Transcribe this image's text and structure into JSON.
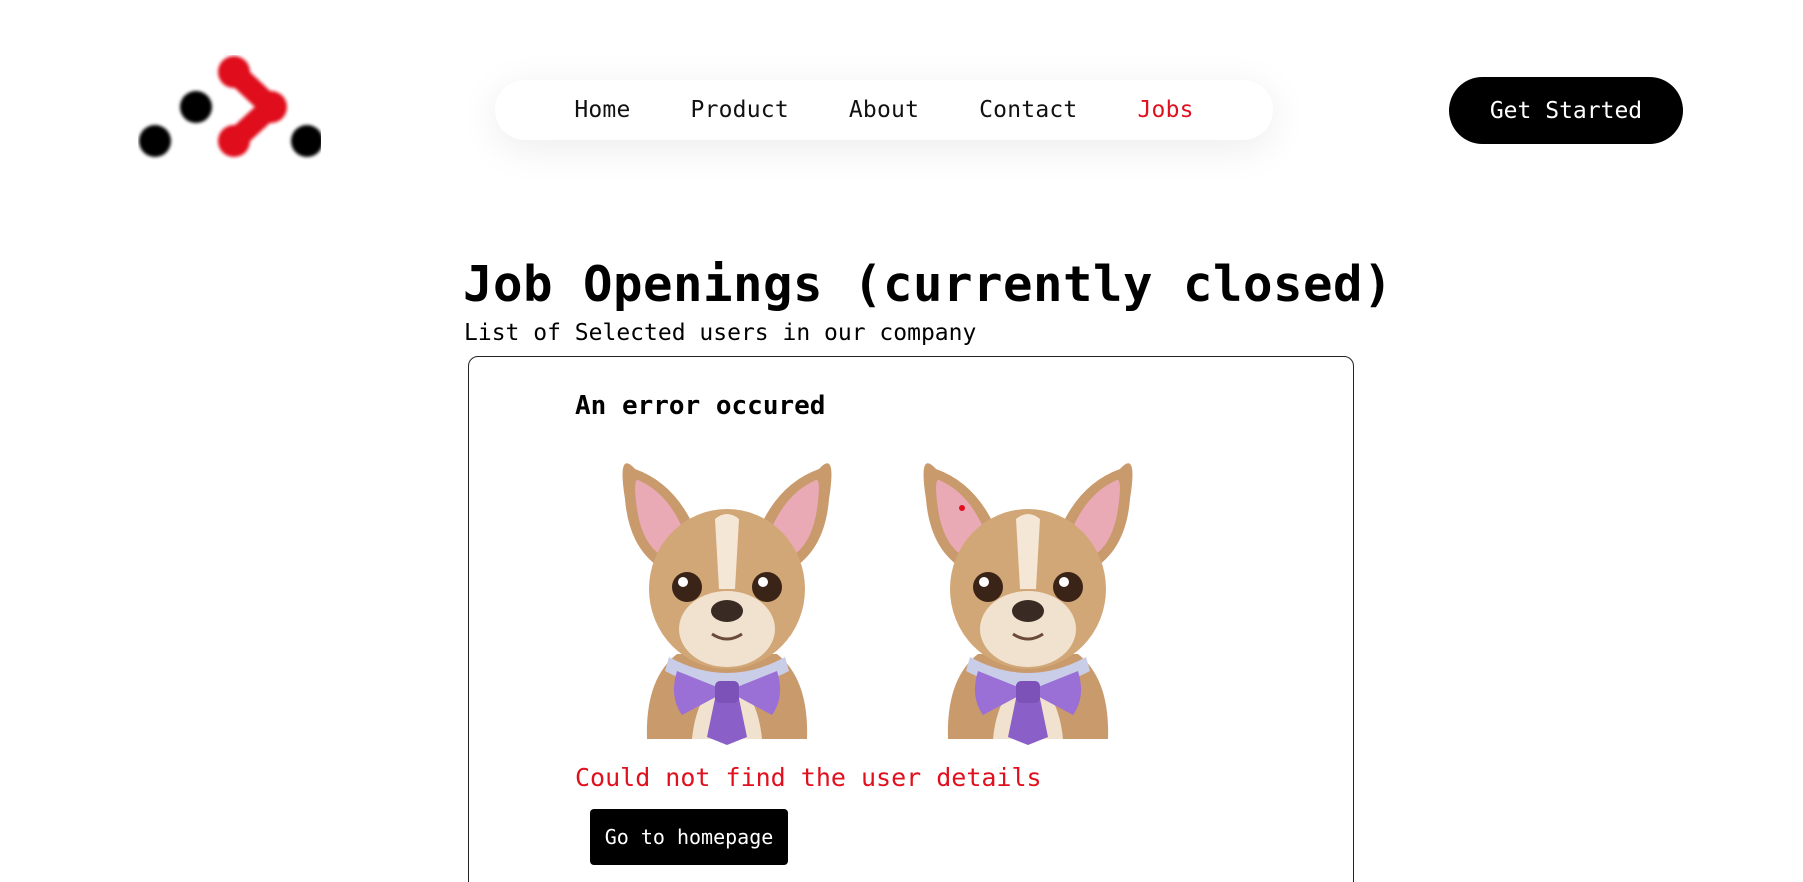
{
  "header": {
    "logo_name": "brand-logo",
    "nav": [
      {
        "label": "Home",
        "active": false
      },
      {
        "label": "Product",
        "active": false
      },
      {
        "label": "About",
        "active": false
      },
      {
        "label": "Contact",
        "active": false
      },
      {
        "label": "Jobs",
        "active": true
      }
    ],
    "cta_label": "Get Started"
  },
  "main": {
    "title": "Job Openings (currently closed)",
    "subtitle": "List of Selected users in our company",
    "card": {
      "error_title": "An error occured",
      "images": [
        "french-bulldog-bowtie-image",
        "french-bulldog-bowtie-image"
      ],
      "error_message": "Could not find the user details",
      "home_button_label": "Go to homepage"
    }
  },
  "colors": {
    "accent": "#e0101e",
    "black": "#000000",
    "background": "#ffffff"
  }
}
